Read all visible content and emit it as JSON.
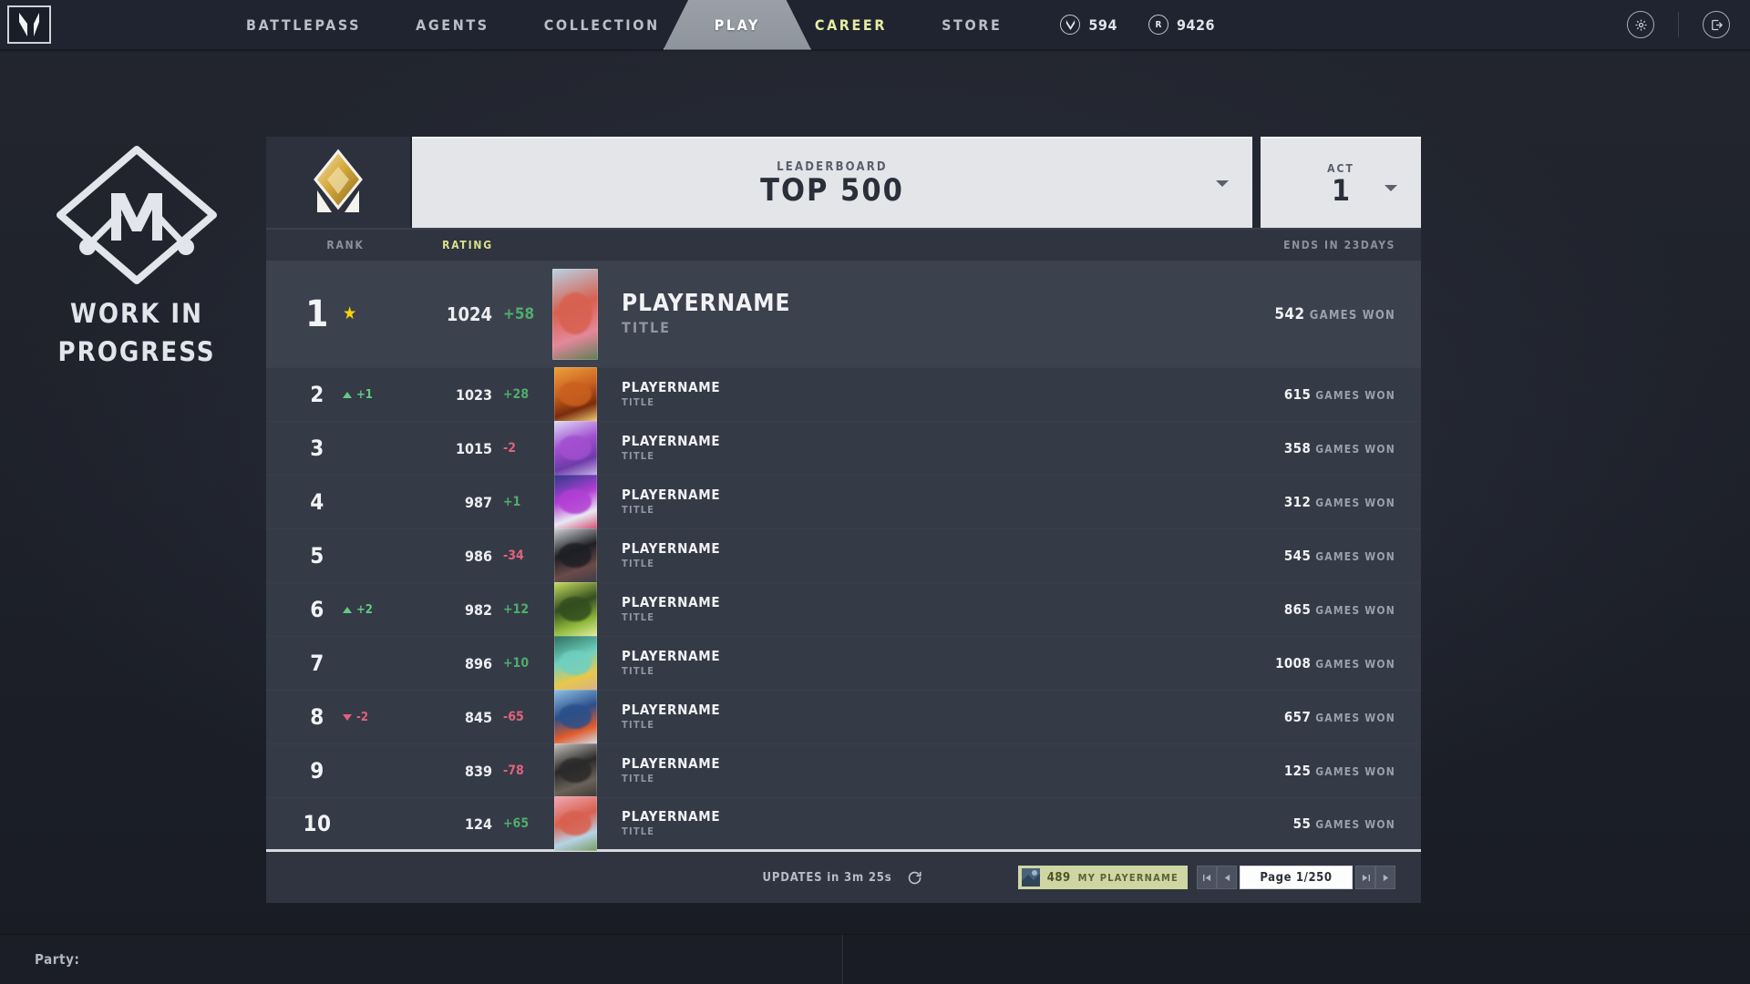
{
  "nav": {
    "logo": "valorant-logo",
    "tabs": [
      {
        "label": "BATTLEPASS",
        "active": false,
        "accent": false
      },
      {
        "label": "AGENTS",
        "active": false,
        "accent": false
      },
      {
        "label": "COLLECTION",
        "active": false,
        "accent": false
      },
      {
        "label": "PLAY",
        "active": true,
        "accent": false
      },
      {
        "label": "CAREER",
        "active": false,
        "accent": true
      },
      {
        "label": "STORE",
        "active": false,
        "accent": false
      }
    ],
    "currencies": [
      {
        "icon": "valorant-points-icon",
        "symbol": "V",
        "value": "594"
      },
      {
        "icon": "radianite-points-icon",
        "symbol": "R",
        "value": "9426"
      }
    ],
    "settings_icon": "gear-icon",
    "exit_icon": "exit-icon"
  },
  "wip": {
    "icon": "wrench-diamond-icon",
    "line1": "WORK IN",
    "line2": "PROGRESS"
  },
  "leaderboard": {
    "rank_badge_icon": "radiant-rank-icon",
    "kicker": "LEADERBOARD",
    "title": "TOP 500",
    "act_kicker": "ACT",
    "act_value": "1",
    "headers": {
      "rank": "RANK",
      "rating": "RATING",
      "ends_in": "ENDS IN 23DAYS"
    },
    "games_won_label": "GAMES WON",
    "rows": [
      {
        "rank": "1",
        "star": true,
        "move": null,
        "move_dir": null,
        "rating": "1024",
        "delta": "+58",
        "delta_sign": "pos",
        "name": "PLAYERNAME",
        "title": "TITLE",
        "games_won": "542",
        "card_colors": [
          "#d8604f",
          "#b6d3e6",
          "#e4889a",
          "#5e7e55"
        ]
      },
      {
        "rank": "2",
        "star": false,
        "move": "+1",
        "move_dir": "up",
        "rating": "1023",
        "delta": "+28",
        "delta_sign": "pos",
        "name": "PLAYERNAME",
        "title": "TITLE",
        "games_won": "615",
        "card_colors": [
          "#c9601f",
          "#f0a03c",
          "#7a2c0c",
          "#f6d27a"
        ]
      },
      {
        "rank": "3",
        "star": false,
        "move": null,
        "move_dir": null,
        "rating": "1015",
        "delta": "-2",
        "delta_sign": "neg",
        "name": "PLAYERNAME",
        "title": "TITLE",
        "games_won": "358",
        "card_colors": [
          "#a24fd0",
          "#dcdcf5",
          "#6d3ba8",
          "#c9b7e8"
        ]
      },
      {
        "rank": "4",
        "star": false,
        "move": null,
        "move_dir": null,
        "rating": "987",
        "delta": "+1",
        "delta_sign": "pos",
        "name": "PLAYERNAME",
        "title": "TITLE",
        "games_won": "312",
        "card_colors": [
          "#b23fd4",
          "#2b3a8a",
          "#e8e8f2",
          "#d44a6e"
        ]
      },
      {
        "rank": "5",
        "star": false,
        "move": null,
        "move_dir": null,
        "rating": "986",
        "delta": "-34",
        "delta_sign": "neg",
        "name": "PLAYERNAME",
        "title": "TITLE",
        "games_won": "545",
        "card_colors": [
          "#1d1f24",
          "#cfd2d8",
          "#6b4a4a",
          "#3a3d46"
        ]
      },
      {
        "rank": "6",
        "star": false,
        "move": "+2",
        "move_dir": "up",
        "rating": "982",
        "delta": "+12",
        "delta_sign": "pos",
        "name": "PLAYERNAME",
        "title": "TITLE",
        "games_won": "865",
        "card_colors": [
          "#334d1f",
          "#c8e060",
          "#8fb83a",
          "#e6f0a8"
        ]
      },
      {
        "rank": "7",
        "star": false,
        "move": null,
        "move_dir": null,
        "rating": "896",
        "delta": "+10",
        "delta_sign": "pos",
        "name": "PLAYERNAME",
        "title": "TITLE",
        "games_won": "1008",
        "card_colors": [
          "#6fd0c0",
          "#2e6f5c",
          "#e8c84a",
          "#d8b08c"
        ]
      },
      {
        "rank": "8",
        "star": false,
        "move": "-2",
        "move_dir": "down",
        "rating": "845",
        "delta": "-65",
        "delta_sign": "neg",
        "name": "PLAYERNAME",
        "title": "TITLE",
        "games_won": "657",
        "card_colors": [
          "#2b4f8a",
          "#8fc2e6",
          "#e05a2a",
          "#cfe2f0"
        ]
      },
      {
        "rank": "9",
        "star": false,
        "move": null,
        "move_dir": null,
        "rating": "839",
        "delta": "-78",
        "delta_sign": "neg",
        "name": "PLAYERNAME",
        "title": "TITLE",
        "games_won": "125",
        "card_colors": [
          "#2a2a2a",
          "#c8c4bc",
          "#6a6258",
          "#3a3632"
        ]
      },
      {
        "rank": "10",
        "star": false,
        "move": null,
        "move_dir": null,
        "rating": "124",
        "delta": "+65",
        "delta_sign": "pos",
        "name": "PLAYERNAME",
        "title": "TITLE",
        "games_won": "55",
        "card_colors": [
          "#d8604f",
          "#f0a8b4",
          "#b6d3e6",
          "#7a9a5e"
        ]
      }
    ],
    "footer": {
      "updates_text": "UPDATES in 3m 25s",
      "refresh_icon": "refresh-icon",
      "my_rank": "489",
      "my_name": "MY PLAYERNAME",
      "first_page_icon": "first-page-icon",
      "prev_page_icon": "prev-page-icon",
      "page_text": "Page 1/250",
      "last_page_icon": "last-page-icon",
      "next_page_icon": "next-page-icon"
    }
  },
  "party": {
    "label": "Party:"
  }
}
